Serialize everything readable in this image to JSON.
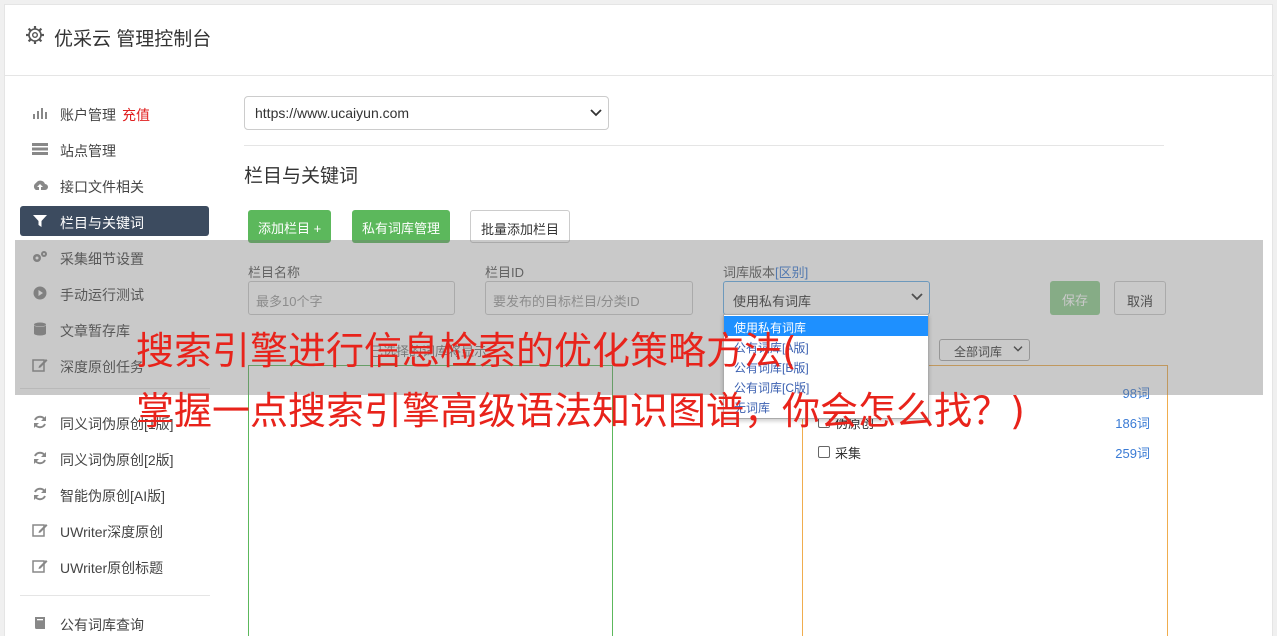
{
  "header": {
    "title": "优采云 管理控制台"
  },
  "sidebar": {
    "items": [
      {
        "label": "账户管理",
        "badge": "充值",
        "icon": "bar-chart-icon"
      },
      {
        "label": "站点管理",
        "icon": "server-icon"
      },
      {
        "label": "接口文件相关",
        "icon": "cloud-upload-icon"
      },
      {
        "label": "栏目与关键词",
        "icon": "filter-icon",
        "active": true
      },
      {
        "label": "采集细节设置",
        "icon": "gears-icon"
      },
      {
        "label": "手动运行测试",
        "icon": "play-circle-icon"
      },
      {
        "label": "文章暂存库",
        "icon": "database-icon"
      },
      {
        "label": "深度原创任务",
        "icon": "edit-icon"
      },
      {
        "label": "同义词伪原创[1版]",
        "icon": "refresh-icon"
      },
      {
        "label": "同义词伪原创[2版]",
        "icon": "refresh-icon"
      },
      {
        "label": "智能伪原创[AI版]",
        "icon": "refresh-icon"
      },
      {
        "label": "UWriter深度原创",
        "icon": "edit-icon"
      },
      {
        "label": "UWriter原创标题",
        "icon": "edit-icon"
      },
      {
        "label": "公有词库查询",
        "icon": "book-icon"
      }
    ]
  },
  "main": {
    "site_select": "https://www.ucaiyun.com",
    "section_title": "栏目与关键词",
    "buttons": {
      "add_column": "添加栏目 +",
      "private_lib": "私有词库管理",
      "batch_add": "批量添加栏目"
    },
    "form": {
      "name_label": "栏目名称",
      "name_placeholder": "最多10个字",
      "id_label": "栏目ID",
      "id_placeholder": "要发布的目标栏目/分类ID",
      "version_label": "词库版本",
      "version_link": "[区别]",
      "version_value": "使用私有词库",
      "save": "保存",
      "cancel": "取消"
    },
    "dropdown_options": [
      "使用私有词库",
      "公有词库[A版]",
      "公有词库[B版]",
      "公有词库[C版]",
      "无词库"
    ],
    "hint": "已选择的词库将显示",
    "filter_select": "全部词库",
    "libraries": [
      {
        "name": "",
        "count": "98词"
      },
      {
        "name": "伪原创",
        "count": "186词"
      },
      {
        "name": "采集",
        "count": "259词"
      }
    ]
  },
  "watermark": {
    "line1": "搜索引擎进行信息检索的优化策略方法(",
    "line2": "掌握一点搜索引擎高级语法知识图谱，你会怎么找？)"
  },
  "colors": {
    "green": "#5cb85c",
    "sidebar_active": "#3c4b5f",
    "watermark": "#e8231b",
    "link": "#3a7bd5"
  }
}
